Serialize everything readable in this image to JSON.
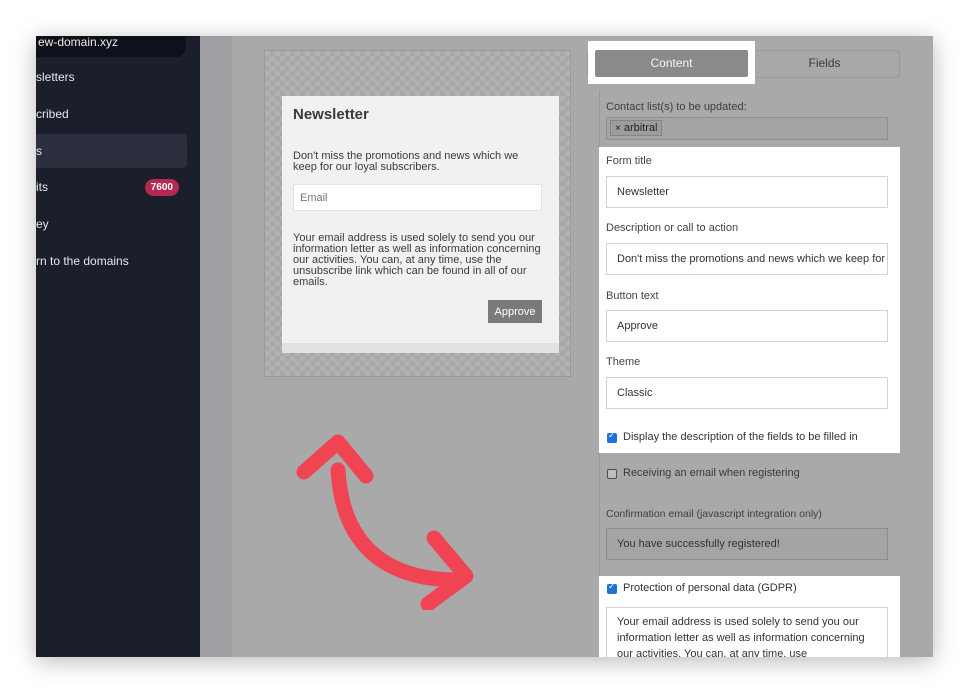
{
  "sidebar": {
    "domain": "ew-domain.xyz",
    "items": [
      {
        "label": "sletters"
      },
      {
        "label": "cribed"
      },
      {
        "label": "s"
      },
      {
        "label": "its",
        "badge": "7600"
      },
      {
        "label": "ey"
      },
      {
        "label": "rn to the domains"
      }
    ]
  },
  "preview": {
    "title": "Newsletter",
    "description": "Don't miss the promotions and news which we keep for our loyal subscribers.",
    "email_placeholder": "Email",
    "gdpr_text": "Your email address is used solely to send you our information letter as well as information concerning our activities. You can, at any time, use the unsubscribe link which can be found in all of our emails.",
    "button": "Approve"
  },
  "tabs": {
    "content": "Content",
    "fields": "Fields"
  },
  "settings": {
    "contact_lists_label": "Contact list(s) to be updated:",
    "contact_list_tag": "arbitral",
    "form_title_label": "Form title",
    "form_title_value": "Newsletter",
    "description_label": "Description or call to action",
    "description_value": "Don't miss the promotions and news which we keep for our loyal subscribers.",
    "button_text_label": "Button text",
    "button_text_value": "Approve",
    "theme_label": "Theme",
    "theme_value": "Classic",
    "display_description_label": "Display the description of the fields to be filled in",
    "display_description_checked": true,
    "receive_email_label": "Receiving an email when registering",
    "receive_email_checked": false,
    "confirmation_label": "Confirmation email (javascript integration only)",
    "confirmation_value": "You have successfully registered!",
    "gdpr_label": "Protection of personal data (GDPR)",
    "gdpr_checked": true,
    "gdpr_value": "Your email address is used solely to send you our information letter as well as information concerning our activities. You can, at any time, use"
  },
  "colors": {
    "accent_blue": "#1f72d6",
    "badge": "#b3294f",
    "arrow": "#f04452",
    "sidebar": "#1b1e2b"
  }
}
